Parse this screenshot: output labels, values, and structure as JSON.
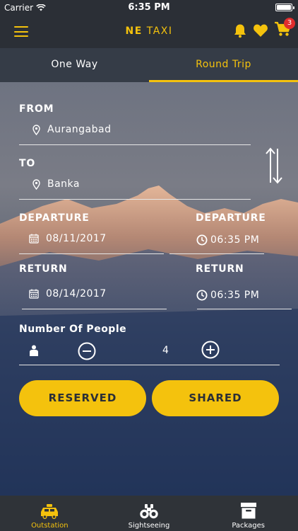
{
  "status_bar": {
    "carrier": "Carrier",
    "time": "6:35 PM"
  },
  "nav": {
    "title_bold": "NE",
    "title_rest": "TAXI",
    "cart_count": "3"
  },
  "tabs": [
    {
      "label": "One Way",
      "active": false
    },
    {
      "label": "Round Trip",
      "active": true
    }
  ],
  "form": {
    "from_label": "FROM",
    "from_value": "Aurangabad",
    "to_label": "TO",
    "to_value": "Banka",
    "departure_date_label": "DEPARTURE",
    "departure_date": "08/11/2017",
    "departure_time_label": "DEPARTURE",
    "departure_time": "06:35 PM",
    "return_date_label": "RETURN",
    "return_date": "08/14/2017",
    "return_time_label": "RETURN",
    "return_time": "06:35 PM",
    "people_label": "Number Of People",
    "people_count": "4"
  },
  "buttons": {
    "reserved": "RESERVED",
    "shared": "SHARED"
  },
  "bottom_nav": [
    {
      "label": "Outstation",
      "icon": "taxi-icon",
      "active": true
    },
    {
      "label": "Sightseeing",
      "icon": "binoculars-icon",
      "active": false
    },
    {
      "label": "Packages",
      "icon": "archive-box-icon",
      "active": false
    }
  ],
  "colors": {
    "accent": "#f4c20d",
    "bar": "#2b2f36",
    "badge": "#e02d2d"
  }
}
